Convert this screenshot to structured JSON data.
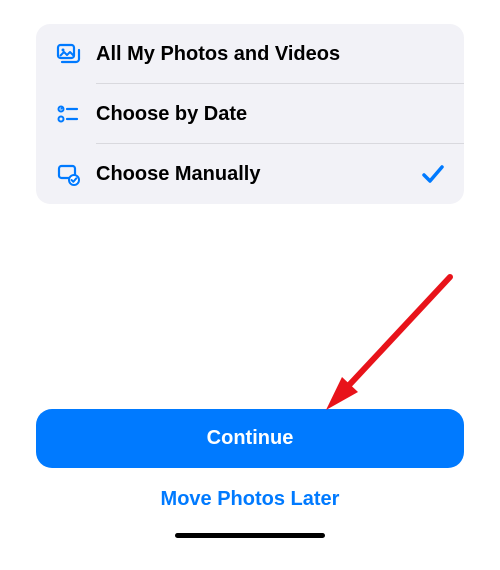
{
  "options": [
    {
      "label": "All My Photos and Videos",
      "selected": false,
      "icon": "photos-stack-icon"
    },
    {
      "label": "Choose by Date",
      "selected": false,
      "icon": "list-filter-icon"
    },
    {
      "label": "Choose Manually",
      "selected": true,
      "icon": "device-check-icon"
    }
  ],
  "buttons": {
    "continue": "Continue",
    "later": "Move Photos Later"
  },
  "colors": {
    "accent": "#007aff",
    "list_bg": "#f2f2f7"
  }
}
